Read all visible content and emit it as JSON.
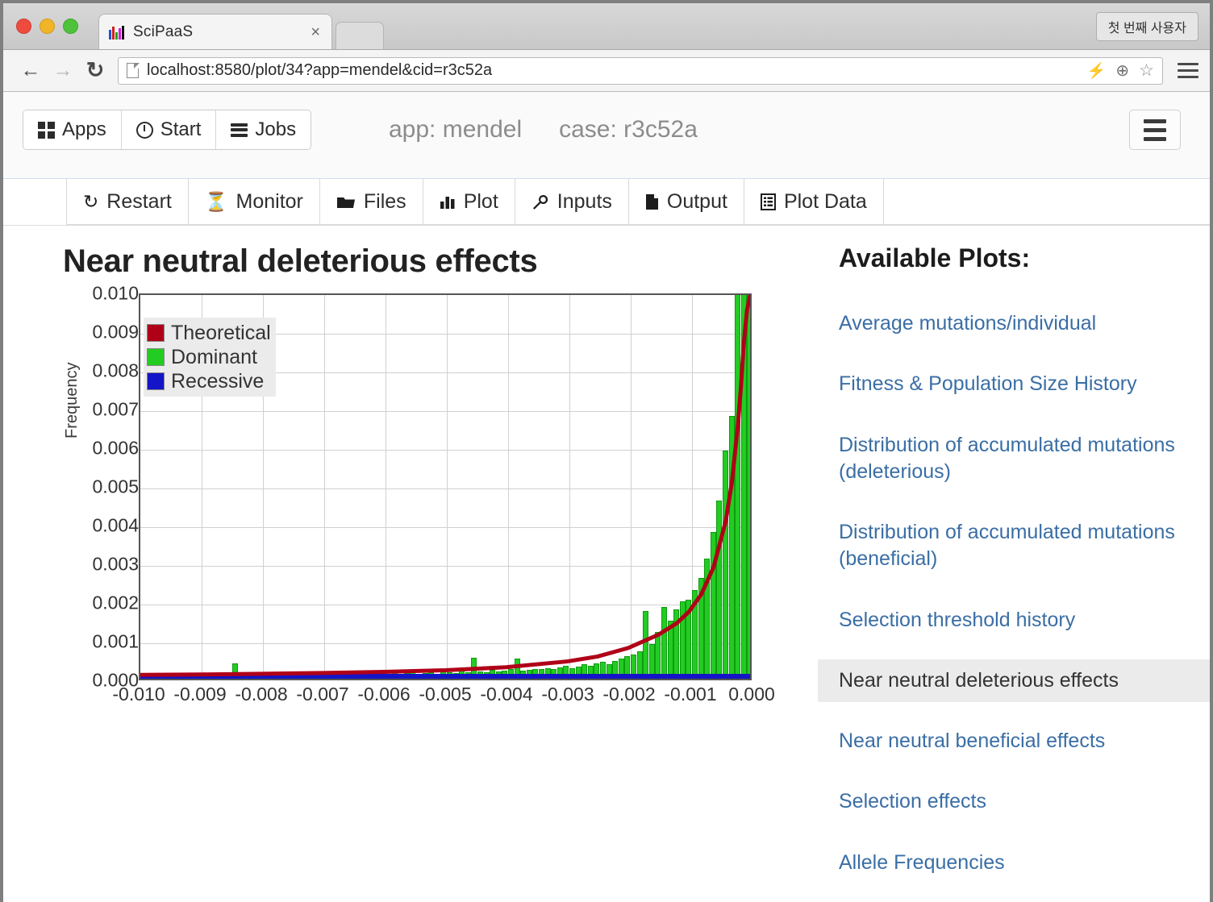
{
  "browser": {
    "tab_title": "SciPaaS",
    "tab_close": "×",
    "profile_label": "첫 번째 사용자",
    "back_icon": "←",
    "forward_icon": "→",
    "reload_icon": "↻",
    "url": "localhost:8580/plot/34?app=mendel&cid=r3c52a",
    "bolt_icon": "⚡",
    "zoom_icon": "⊕",
    "star_icon": "☆"
  },
  "app_header": {
    "buttons": [
      {
        "label": "Apps",
        "icon": "grid-icon"
      },
      {
        "label": "Start",
        "icon": "play-circle-icon"
      },
      {
        "label": "Jobs",
        "icon": "stack-icon"
      }
    ],
    "app_meta": "app: mendel",
    "case_meta": "case: r3c52a"
  },
  "nav_tabs": [
    {
      "label": "Restart",
      "icon": "↻"
    },
    {
      "label": "Monitor",
      "icon": "⌛"
    },
    {
      "label": "Files",
      "icon": "📁"
    },
    {
      "label": "Plot",
      "icon": "█"
    },
    {
      "label": "Inputs",
      "icon": "🔧"
    },
    {
      "label": "Output",
      "icon": "🗎"
    },
    {
      "label": "Plot Data",
      "icon": "☷"
    }
  ],
  "sidebar": {
    "title": "Available Plots:",
    "items": [
      {
        "label": "Average mutations/individual",
        "active": false
      },
      {
        "label": "Fitness & Population Size History",
        "active": false
      },
      {
        "label": "Distribution of accumulated mutations (deleterious)",
        "active": false
      },
      {
        "label": "Distribution of accumulated mutations (beneficial)",
        "active": false
      },
      {
        "label": "Selection threshold history",
        "active": false
      },
      {
        "label": "Near neutral deleterious effects",
        "active": true
      },
      {
        "label": "Near neutral beneficial effects",
        "active": false
      },
      {
        "label": "Selection effects",
        "active": false
      },
      {
        "label": "Allele Frequencies",
        "active": false
      }
    ]
  },
  "chart_data": {
    "type": "bar",
    "title": "Near neutral deleterious effects",
    "xlabel": "",
    "ylabel": "Frequency",
    "xlim": [
      -0.01,
      0.0
    ],
    "ylim": [
      0.0,
      0.01
    ],
    "grid": true,
    "legend_position": "upper left",
    "xticks": [
      "-0.010",
      "-0.009",
      "-0.008",
      "-0.007",
      "-0.006",
      "-0.005",
      "-0.004",
      "-0.003",
      "-0.002",
      "-0.001",
      "0.000"
    ],
    "xtick_values": [
      -0.01,
      -0.009,
      -0.008,
      -0.007,
      -0.006,
      -0.005,
      -0.004,
      -0.003,
      -0.002,
      -0.001,
      0.0
    ],
    "yticks": [
      "0.000",
      "0.001",
      "0.002",
      "0.003",
      "0.004",
      "0.005",
      "0.006",
      "0.007",
      "0.008",
      "0.009",
      "0.010"
    ],
    "ytick_values": [
      0.0,
      0.001,
      0.002,
      0.003,
      0.004,
      0.005,
      0.006,
      0.007,
      0.008,
      0.009,
      0.01
    ],
    "legend": [
      {
        "name": "Theoretical",
        "color": "#b00018"
      },
      {
        "name": "Dominant",
        "color": "#22cc22"
      },
      {
        "name": "Recessive",
        "color": "#1414c8"
      }
    ],
    "series": [
      {
        "name": "Dominant",
        "color": "#22cc22",
        "type": "bar",
        "x": [
          -0.00995,
          -0.00985,
          -0.00975,
          -0.00965,
          -0.00955,
          -0.00945,
          -0.00935,
          -0.00925,
          -0.00915,
          -0.00905,
          -0.00895,
          -0.00885,
          -0.00875,
          -0.00865,
          -0.00855,
          -0.00845,
          -0.00835,
          -0.00825,
          -0.00815,
          -0.00805,
          -0.00795,
          -0.00785,
          -0.00775,
          -0.00765,
          -0.00755,
          -0.00745,
          -0.00735,
          -0.00725,
          -0.00715,
          -0.00705,
          -0.00695,
          -0.00685,
          -0.00675,
          -0.00665,
          -0.00655,
          -0.00645,
          -0.00635,
          -0.00625,
          -0.00615,
          -0.00605,
          -0.00595,
          -0.00585,
          -0.00575,
          -0.00565,
          -0.00555,
          -0.00545,
          -0.00535,
          -0.00525,
          -0.00515,
          -0.00505,
          -0.00495,
          -0.00485,
          -0.00475,
          -0.00465,
          -0.00455,
          -0.00445,
          -0.00435,
          -0.00425,
          -0.00415,
          -0.00405,
          -0.00395,
          -0.00385,
          -0.00375,
          -0.00365,
          -0.00355,
          -0.00345,
          -0.00335,
          -0.00325,
          -0.00315,
          -0.00305,
          -0.00295,
          -0.00285,
          -0.00275,
          -0.00265,
          -0.00255,
          -0.00245,
          -0.00235,
          -0.00225,
          -0.00215,
          -0.00205,
          -0.00195,
          -0.00185,
          -0.00175,
          -0.00165,
          -0.00155,
          -0.00145,
          -0.00135,
          -0.00125,
          -0.00115,
          -0.00105,
          -0.00095,
          -0.00085,
          -0.00075,
          -0.00065,
          -0.00055,
          -0.00045,
          -0.00035,
          -0.00025,
          -0.00015,
          -5e-05
        ],
        "values": [
          8e-05,
          4e-05,
          6e-05,
          0.0001,
          4e-05,
          8e-05,
          0.00012,
          6e-05,
          4e-05,
          0.0001,
          8e-05,
          6e-05,
          0.00012,
          8e-05,
          0.0001,
          0.0004,
          8e-05,
          6e-05,
          0.0001,
          8e-05,
          0.00012,
          8e-05,
          0.0001,
          6e-05,
          0.00012,
          8e-05,
          0.00014,
          0.0001,
          8e-05,
          0.00012,
          0.0001,
          0.00014,
          8e-05,
          0.00012,
          0.0001,
          0.00016,
          0.00012,
          0.0001,
          0.00014,
          0.00012,
          0.0001,
          0.00016,
          0.00012,
          0.00014,
          0.00018,
          0.00012,
          0.00014,
          0.00016,
          0.00012,
          0.00018,
          0.00016,
          0.00014,
          0.0002,
          0.00016,
          0.00055,
          0.00018,
          0.00016,
          0.00022,
          0.00018,
          0.0002,
          0.00024,
          0.00052,
          0.0002,
          0.00022,
          0.00026,
          0.00024,
          0.00028,
          0.00024,
          0.0003,
          0.00034,
          0.00028,
          0.00032,
          0.00038,
          0.00034,
          0.0004,
          0.00044,
          0.00038,
          0.00046,
          0.00052,
          0.00058,
          0.00062,
          0.0007,
          0.00175,
          0.0009,
          0.0012,
          0.00185,
          0.0015,
          0.0018,
          0.002,
          0.00205,
          0.0023,
          0.0026,
          0.0031,
          0.0038,
          0.0046,
          0.0059,
          0.0068,
          0.01,
          0.01,
          0.01
        ]
      },
      {
        "name": "Theoretical",
        "color": "#b00018",
        "type": "line",
        "x": [
          -0.01,
          -0.009,
          -0.008,
          -0.007,
          -0.006,
          -0.005,
          -0.004,
          -0.003,
          -0.0025,
          -0.002,
          -0.0015,
          -0.0012,
          -0.001,
          -0.0008,
          -0.0006,
          -0.0004,
          -0.0003,
          -0.0002,
          -0.00015,
          -0.0001,
          -5e-05,
          0.0
        ],
        "values": [
          0.0001,
          0.00011,
          0.00013,
          0.00015,
          0.00018,
          0.00022,
          0.0003,
          0.00045,
          0.00058,
          0.0008,
          0.00115,
          0.00145,
          0.00175,
          0.0022,
          0.0029,
          0.0041,
          0.0051,
          0.0066,
          0.0076,
          0.0088,
          0.0096,
          0.01
        ]
      },
      {
        "name": "Recessive",
        "color": "#1414c8",
        "type": "bar",
        "constant_value": 5e-05,
        "note": "flat at baseline across full range"
      }
    ]
  }
}
